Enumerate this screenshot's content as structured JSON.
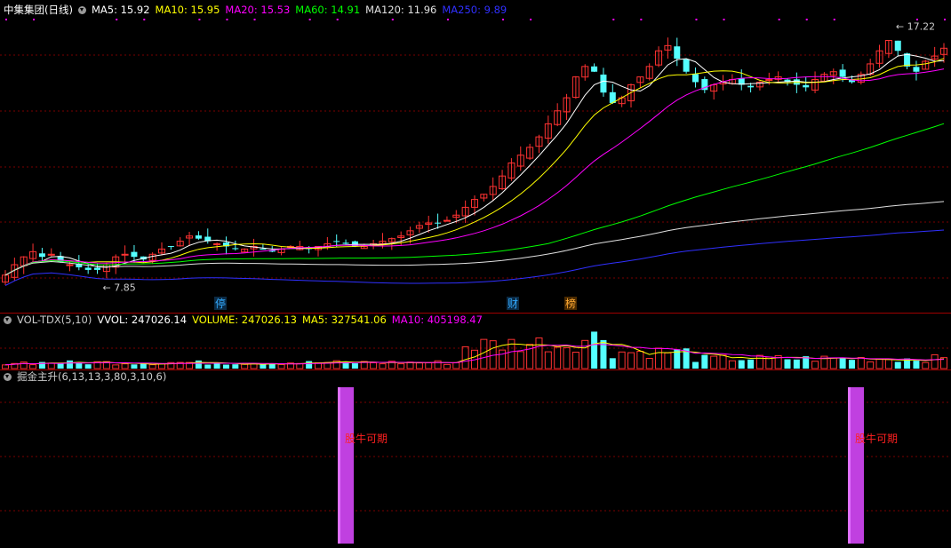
{
  "main_header": {
    "stock": "中集集团(日线)",
    "items": [
      {
        "label": "MA5: 15.92",
        "color": "#ffffff"
      },
      {
        "label": "MA10: 15.95",
        "color": "#ffff00"
      },
      {
        "label": "MA20: 15.53",
        "color": "#ff00ff"
      },
      {
        "label": "MA60: 14.91",
        "color": "#00ff00"
      },
      {
        "label": "MA120: 11.96",
        "color": "#e0e0e0"
      },
      {
        "label": "MA250: 9.89",
        "color": "#3030ff"
      }
    ]
  },
  "price_labels": {
    "high": "17.22",
    "low": "7.85"
  },
  "event_markers": [
    {
      "label": "停",
      "color": "#33aaff",
      "color_bg": "#0b2a44"
    },
    {
      "label": "财",
      "color": "#33aaff",
      "color_bg": "#0b2a44"
    },
    {
      "label": "榜",
      "color": "#ffaa33",
      "color_bg": "#4a2a00"
    }
  ],
  "vol_header": {
    "title": "VOL-TDX(5,10)",
    "items": [
      {
        "label": "VVOL: 247026.14",
        "color": "#ffffff"
      },
      {
        "label": "VOLUME: 247026.13",
        "color": "#ffff00"
      },
      {
        "label": "MA5: 327541.06",
        "color": "#ffff00"
      },
      {
        "label": "MA10: 405198.47",
        "color": "#ff00ff"
      }
    ]
  },
  "ind_header": {
    "title": "掘金主升(6,13,13,3,80,3,10,6)"
  },
  "signals": [
    {
      "label": "股牛可期"
    },
    {
      "label": "股牛可期"
    }
  ],
  "colors": {
    "up": "#ff3232",
    "down": "#54ffff",
    "grid": "#7a0000",
    "bar_signal": "#c040e0"
  },
  "chart_data": {
    "type": "candlestick",
    "title": "中集集团(日线)",
    "ylim": [
      7.0,
      18.0
    ],
    "closes": [
      8.2,
      8.6,
      8.9,
      9.1,
      8.9,
      9.0,
      8.7,
      8.6,
      8.5,
      8.4,
      8.4,
      8.6,
      8.9,
      9.0,
      8.9,
      8.8,
      9.0,
      9.2,
      9.3,
      9.5,
      9.7,
      9.6,
      9.5,
      9.4,
      9.3,
      9.2,
      9.2,
      9.3,
      9.2,
      9.1,
      9.2,
      9.3,
      9.3,
      9.2,
      9.3,
      9.4,
      9.5,
      9.4,
      9.3,
      9.3,
      9.4,
      9.5,
      9.6,
      9.7,
      9.9,
      10.1,
      10.2,
      10.2,
      10.3,
      10.5,
      10.8,
      11.1,
      11.3,
      11.6,
      12.0,
      12.5,
      12.8,
      13.1,
      13.5,
      14.0,
      14.5,
      15.0,
      15.8,
      16.2,
      16.0,
      15.2,
      14.8,
      15.0,
      15.5,
      15.8,
      16.2,
      16.8,
      17.0,
      16.5,
      16.0,
      15.6,
      15.3,
      15.5,
      15.6,
      15.7,
      15.5,
      15.4,
      15.6,
      15.7,
      15.8,
      15.6,
      15.5,
      15.4,
      15.7,
      15.9,
      16.0,
      15.8,
      15.6,
      15.9,
      16.3,
      16.8,
      17.2,
      16.8,
      16.2,
      16.0,
      16.4,
      16.6,
      16.9
    ],
    "volume_ylim": [
      0,
      600000
    ],
    "ma_labels": [
      "MA5",
      "MA10",
      "MA20",
      "MA60",
      "MA120",
      "MA250"
    ]
  }
}
